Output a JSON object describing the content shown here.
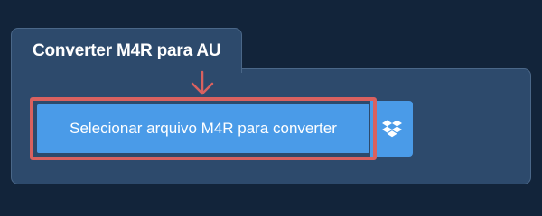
{
  "tab": {
    "title": "Converter M4R para AU"
  },
  "actions": {
    "select_file_label": "Selecionar arquivo M4R para converter",
    "dropbox_icon": "dropbox-icon",
    "arrow_icon": "arrow-down-icon"
  },
  "colors": {
    "page_background": "#12243a",
    "panel_background": "#2d4a6c",
    "button_background": "#4a9be8",
    "highlight": "#d9615f"
  }
}
